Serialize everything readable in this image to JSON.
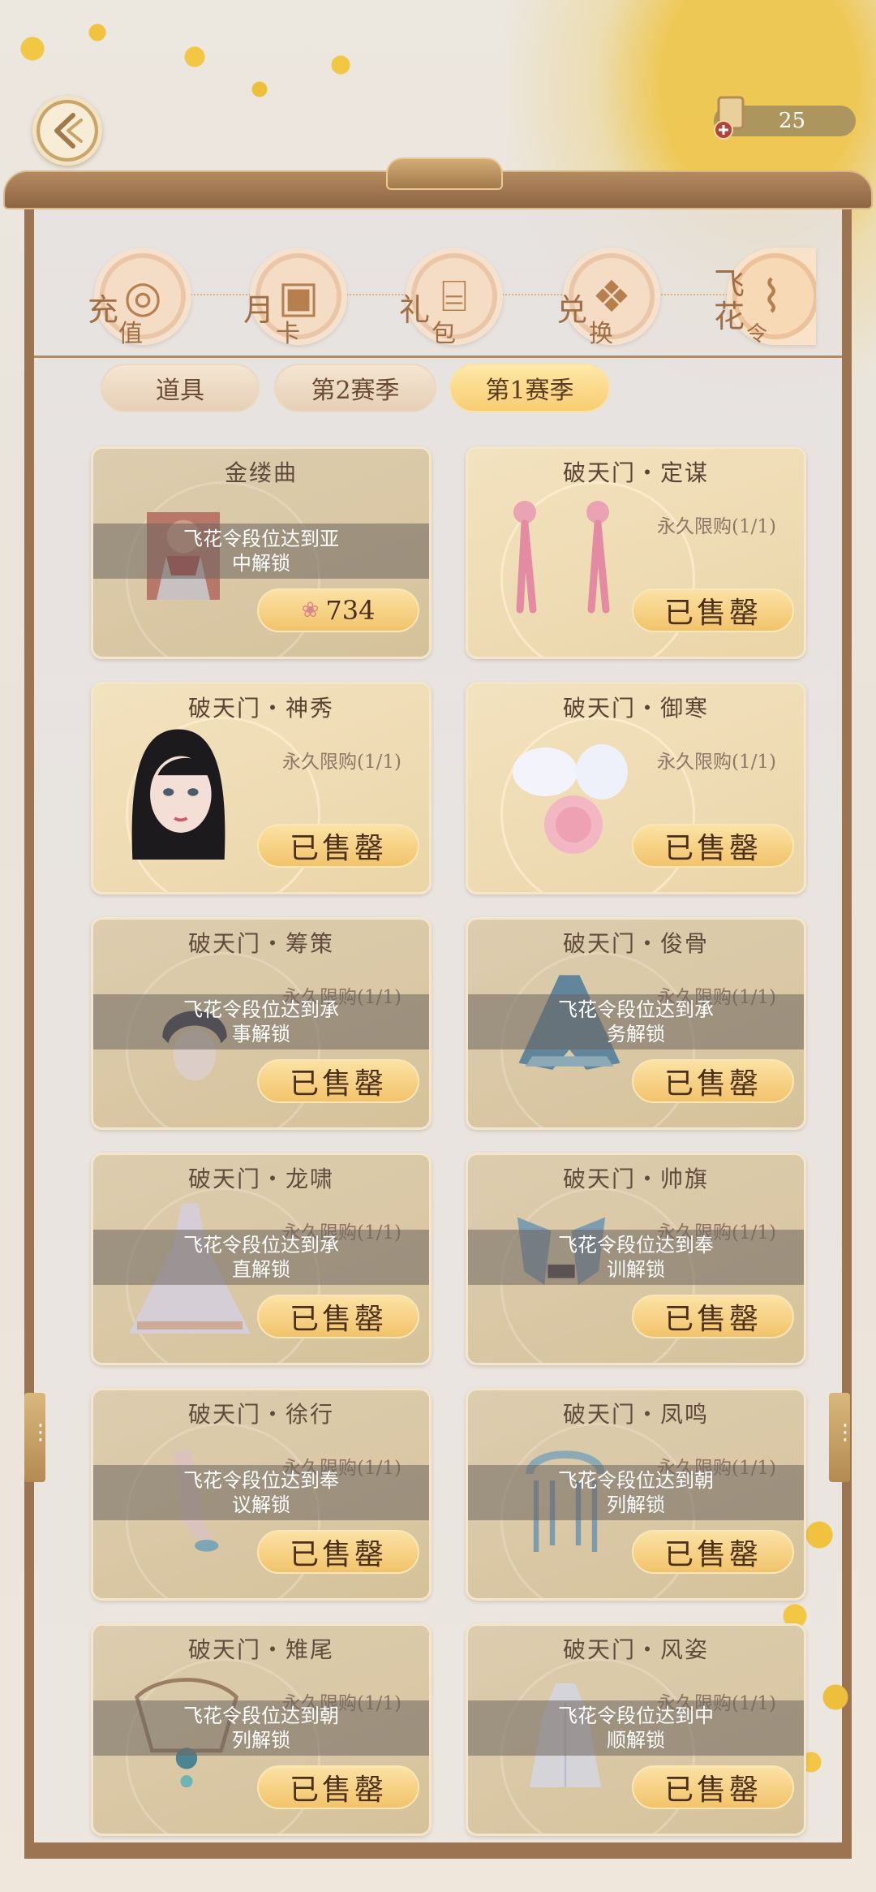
{
  "header": {
    "currency_value": "25"
  },
  "categories": [
    {
      "label_a": "充",
      "label_b": "值",
      "icon": "coin-icon"
    },
    {
      "label_a": "月",
      "label_b": "卡",
      "icon": "card-icon"
    },
    {
      "label_a": "礼",
      "label_b": "包",
      "icon": "gift-box-icon"
    },
    {
      "label_a": "兑",
      "label_b": "换",
      "icon": "present-icon"
    },
    {
      "label_a": "飞",
      "label_b": "花",
      "label_c": "令",
      "icon": "scroll-icon"
    }
  ],
  "tabs": [
    {
      "label": "道具",
      "active": false
    },
    {
      "label": "第2赛季",
      "active": false
    },
    {
      "label": "第1赛季",
      "active": true
    }
  ],
  "cards": [
    {
      "title": "金缕曲",
      "price": "734",
      "lock_line1": "飞花令段位达到亚",
      "lock_line2": "中解锁",
      "item": "costume-portrait"
    },
    {
      "title": "破天门・定谋",
      "limit": "永久限购(1/1)",
      "status": "已售罄",
      "item": "pink-earrings"
    },
    {
      "title": "破天门・神秀",
      "limit": "永久限购(1/1)",
      "status": "已售罄",
      "item": "character-face"
    },
    {
      "title": "破天门・御寒",
      "limit": "永久限购(1/1)",
      "status": "已售罄",
      "item": "fur-earmuffs"
    },
    {
      "title": "破天门・筹策",
      "limit": "永久限购(1/1)",
      "status": "已售罄",
      "lock_line1": "飞花令段位达到承",
      "lock_line2": "事解锁",
      "item": "headpiece"
    },
    {
      "title": "破天门・俊骨",
      "limit": "永久限购(1/1)",
      "status": "已售罄",
      "lock_line1": "飞花令段位达到承",
      "lock_line2": "务解锁",
      "item": "cape"
    },
    {
      "title": "破天门・龙啸",
      "limit": "永久限购(1/1)",
      "status": "已售罄",
      "lock_line1": "飞花令段位达到承",
      "lock_line2": "直解锁",
      "item": "gown"
    },
    {
      "title": "破天门・帅旗",
      "limit": "永久限购(1/1)",
      "status": "已售罄",
      "lock_line1": "飞花令段位达到奉",
      "lock_line2": "训解锁",
      "item": "banners"
    },
    {
      "title": "破天门・徐行",
      "limit": "永久限购(1/1)",
      "status": "已售罄",
      "lock_line1": "飞花令段位达到奉",
      "lock_line2": "议解锁",
      "item": "shoes"
    },
    {
      "title": "破天门・凤鸣",
      "limit": "永久限购(1/1)",
      "status": "已售罄",
      "lock_line1": "飞花令段位达到朝",
      "lock_line2": "列解锁",
      "item": "crown"
    },
    {
      "title": "破天门・雉尾",
      "limit": "永久限购(1/1)",
      "status": "已售罄",
      "lock_line1": "飞花令段位达到朝",
      "lock_line2": "列解锁",
      "item": "necklace"
    },
    {
      "title": "破天门・风姿",
      "limit": "永久限购(1/1)",
      "status": "已售罄",
      "lock_line1": "飞花令段位达到中",
      "lock_line2": "顺解锁",
      "item": "robe"
    }
  ]
}
